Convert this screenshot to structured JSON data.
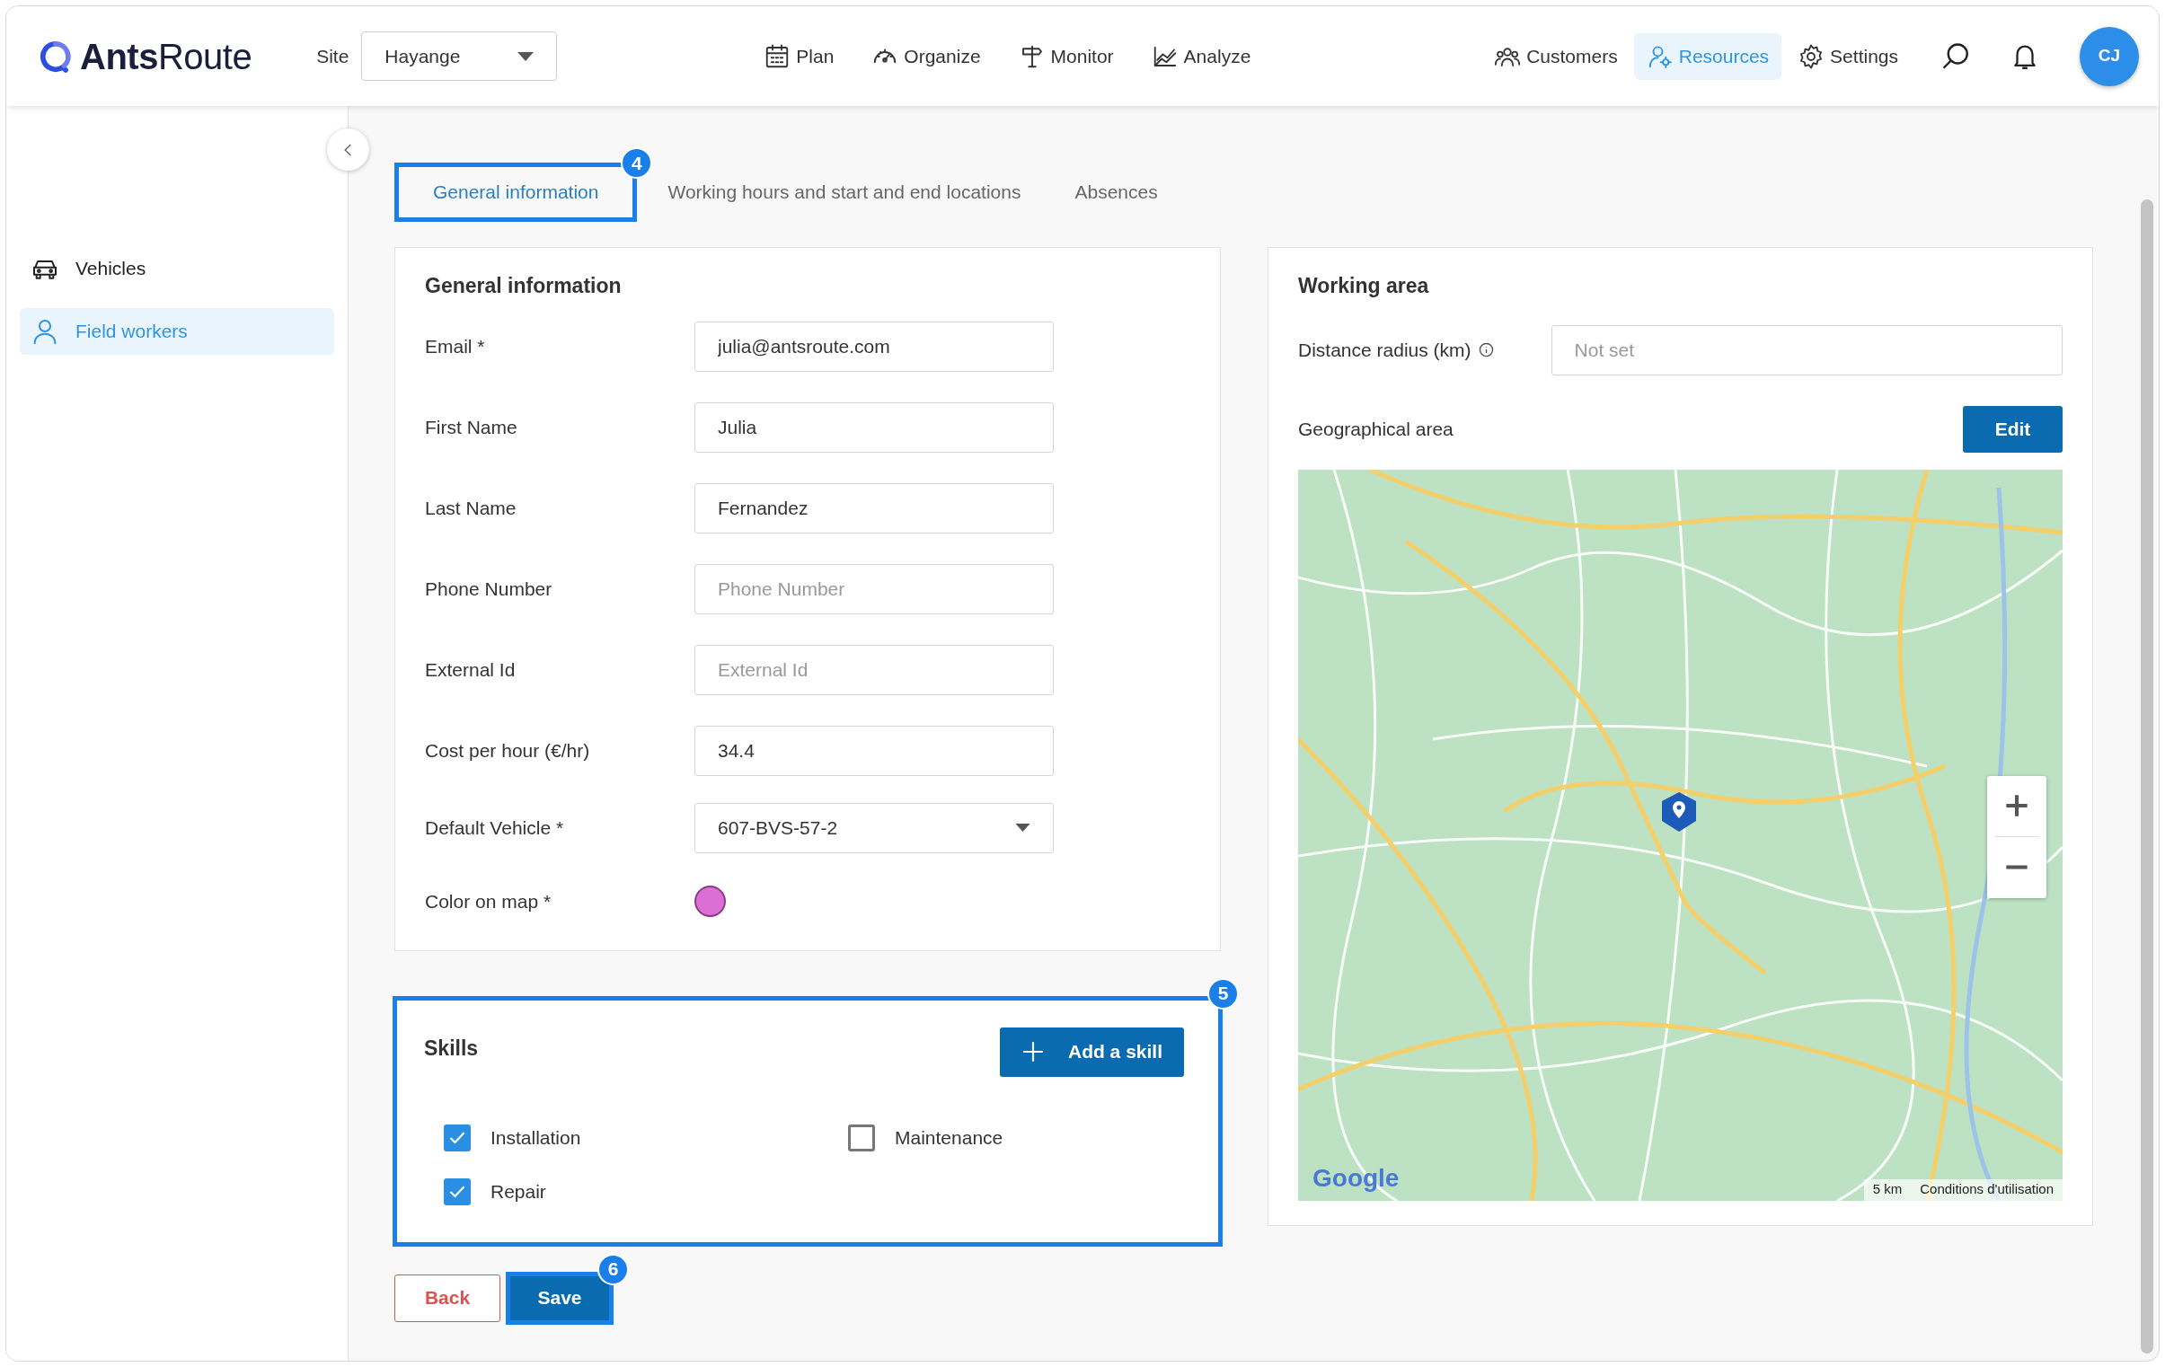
{
  "header": {
    "logo": "**Ants**Route",
    "site_label": "Site",
    "site_select": "Hayange",
    "nav": [
      {
        "label": "Plan",
        "selected": false
      },
      {
        "label": "Organize",
        "selected": false
      },
      {
        "label": "Monitor",
        "selected": false
      },
      {
        "label": "Analyze",
        "selected": false
      }
    ],
    "nav_right": [
      {
        "label": "Customers",
        "selected": false
      },
      {
        "label": "Resources",
        "selected": true
      },
      {
        "label": "Settings",
        "selected": false
      }
    ],
    "avatar": "CJ"
  },
  "sidebar": {
    "items": [
      {
        "label": "Vehicles",
        "selected": false
      },
      {
        "label": "Field workers",
        "selected": true
      }
    ]
  },
  "tabs": [
    {
      "label": "General information",
      "selected": true,
      "badge": "4"
    },
    {
      "label": "Working hours and start and end locations",
      "selected": false
    },
    {
      "label": "Absences",
      "selected": false
    }
  ],
  "general": {
    "title": "General information",
    "fields": [
      {
        "kind": "text",
        "label": "Email *",
        "value": "julia@antsroute.com"
      },
      {
        "kind": "text",
        "label": "First Name",
        "value": "Julia"
      },
      {
        "kind": "text",
        "label": "Last Name",
        "value": "Fernandez"
      },
      {
        "kind": "text",
        "label": "Phone Number",
        "placeholder": "Phone Number"
      },
      {
        "kind": "text",
        "label": "External Id",
        "placeholder": "External Id"
      },
      {
        "kind": "text",
        "label": "Cost per hour (€/hr)",
        "value": "34.4"
      },
      {
        "kind": "select",
        "label": "Default Vehicle *",
        "value": "607-BVS-57-2"
      },
      {
        "kind": "color",
        "label": "Color on map *",
        "color": "#dc6fd6"
      }
    ]
  },
  "skills": {
    "title": "Skills",
    "badge": "5",
    "add_button": "Add a skill",
    "items": [
      {
        "label": "Installation",
        "checked": true
      },
      {
        "label": "Maintenance",
        "checked": false
      },
      {
        "label": "Repair",
        "checked": true
      }
    ]
  },
  "actions": {
    "back": "Back",
    "save": "Save",
    "save_badge": "6"
  },
  "working_area": {
    "title": "Working area",
    "radius_label": "Distance radius (km)",
    "radius_placeholder": "Not set",
    "geo_label": "Geographical area",
    "edit_button": "Edit",
    "map": {
      "logo": "Google",
      "scale": "5 km",
      "terms": "Conditions d'utilisation"
    }
  }
}
